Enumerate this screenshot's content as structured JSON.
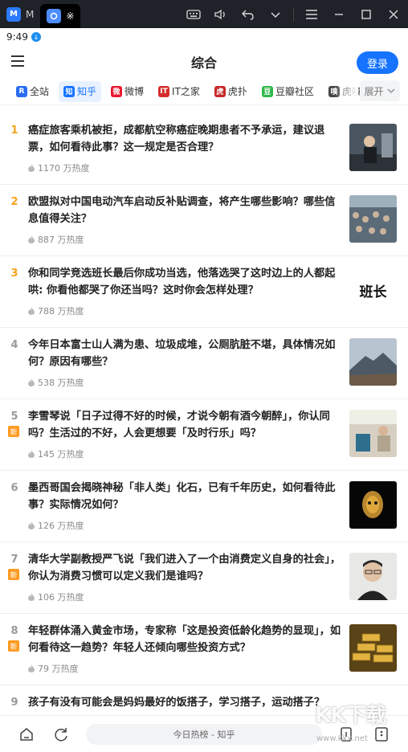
{
  "emulator": {
    "tabs": [
      {
        "label": "M",
        "icon": "app-m-icon"
      },
      {
        "label": "※",
        "icon": "app-browser-icon"
      }
    ]
  },
  "status": {
    "time": "9:49"
  },
  "header": {
    "title": "综合",
    "login_label": "登录"
  },
  "sources": [
    {
      "label": "全站",
      "icon_text": "R",
      "color": "#2a6df4"
    },
    {
      "label": "知乎",
      "icon_text": "知",
      "color": "#1673ff"
    },
    {
      "label": "微博",
      "icon_text": "微",
      "color": "#e6162d"
    },
    {
      "label": "IT之家",
      "icon_text": "IT",
      "color": "#d42d2d"
    },
    {
      "label": "虎扑",
      "icon_text": "虎",
      "color": "#c62828"
    },
    {
      "label": "豆瓣社区",
      "icon_text": "豆",
      "color": "#2eb84a"
    },
    {
      "label": "虎嗅",
      "icon_text": "嗅",
      "color": "#444444"
    }
  ],
  "expand_label": "展开",
  "items": [
    {
      "rank": "1",
      "title": "癌症旅客乘机被拒，成都航空称癌症晚期患者不予承运，建议退票，如何看待此事？这一规定是否合理？",
      "heat": "1170 万热度",
      "is_new": false,
      "thumb": "photo-airport",
      "thumb_text": ""
    },
    {
      "rank": "2",
      "title": "欧盟拟对中国电动汽车启动反补贴调查，将产生哪些影响？哪些信息值得关注？",
      "heat": "887 万热度",
      "is_new": false,
      "thumb": "photo-crowd",
      "thumb_text": ""
    },
    {
      "rank": "3",
      "title": "你和同学竞选班长最后你成功当选，他落选哭了这时边上的人都起哄: 你看他都哭了你还当吗？这时你会怎样处理？",
      "heat": "788 万热度",
      "is_new": false,
      "thumb": "text",
      "thumb_text": "班长"
    },
    {
      "rank": "4",
      "title": "今年日本富士山人满为患、垃圾成堆，公厕肮脏不堪，具体情况如何？原因有哪些？",
      "heat": "538 万热度",
      "is_new": false,
      "thumb": "photo-mountain",
      "thumb_text": ""
    },
    {
      "rank": "5",
      "title": "李雪琴说「日子过得不好的时候，才说今朝有酒今朝醉」，你认同吗？生活过的不好，人会更想要「及时行乐」吗？",
      "heat": "145 万热度",
      "is_new": true,
      "thumb": "photo-room",
      "thumb_text": ""
    },
    {
      "rank": "6",
      "title": "墨西哥国会揭晓神秘「非人类」化石，已有千年历史，如何看待此事？实际情况如何？",
      "heat": "126 万热度",
      "is_new": false,
      "thumb": "photo-skull",
      "thumb_text": ""
    },
    {
      "rank": "7",
      "title": "清华大学副教授严飞说「我们进入了一个由消费定义自身的社会」，你认为消费习惯可以定义我们是谁吗？",
      "heat": "106 万热度",
      "is_new": true,
      "thumb": "photo-portrait",
      "thumb_text": ""
    },
    {
      "rank": "8",
      "title": "年轻群体涌入黄金市场，专家称「这是投资低龄化趋势的显现」，如何看待这一趋势？年轻人还倾向哪些投资方式？",
      "heat": "79 万热度",
      "is_new": true,
      "thumb": "photo-gold",
      "thumb_text": ""
    },
    {
      "rank": "9",
      "title": "孩子有没有可能会是妈妈最好的饭搭子，学习搭子，运动搭子？",
      "heat": "",
      "is_new": false,
      "thumb": "",
      "thumb_text": ""
    }
  ],
  "badge_new": "新",
  "bottom": {
    "url_label": "今日热榜 - 知乎"
  },
  "watermark": {
    "text": "KK下载",
    "url": "www.kkx.net"
  },
  "colors": {
    "accent": "#1673ff",
    "rank_hot": "#f7a21b",
    "badge_new": "#ff9a1f"
  }
}
